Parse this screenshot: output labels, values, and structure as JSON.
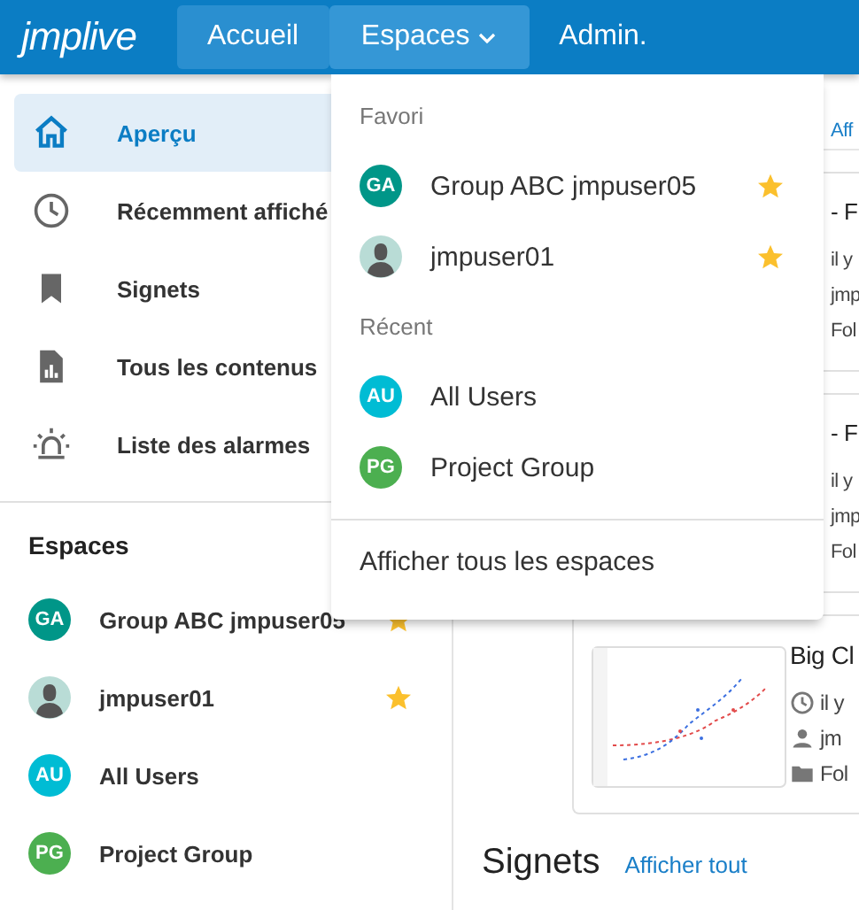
{
  "topbar": {
    "logo": "jmplive",
    "nav": [
      {
        "label": "Accueil",
        "selected": true,
        "open": false,
        "dropdown": false
      },
      {
        "label": "Espaces",
        "selected": false,
        "open": true,
        "dropdown": true
      },
      {
        "label": "Admin.",
        "selected": false,
        "open": false,
        "dropdown": false
      }
    ]
  },
  "sidebar": {
    "items": [
      {
        "label": "Aperçu",
        "kind": "home",
        "selected": true
      },
      {
        "label": "Récemment affiché",
        "kind": "clock",
        "selected": false
      },
      {
        "label": "Signets",
        "kind": "bookmark",
        "selected": false
      },
      {
        "label": "Tous les contenus",
        "kind": "report",
        "selected": false
      },
      {
        "label": "Liste des alarmes",
        "kind": "alarm",
        "selected": false
      }
    ],
    "spaces_title": "Espaces",
    "spaces": [
      {
        "name": "Group ABC jmpuser05",
        "avatar": {
          "kind": "initials",
          "text": "GA",
          "color": "#009688"
        },
        "favorite": true
      },
      {
        "name": "jmpuser01",
        "avatar": {
          "kind": "person"
        },
        "favorite": true
      },
      {
        "name": "All Users",
        "avatar": {
          "kind": "initials",
          "text": "AU",
          "color": "#00bcd4"
        },
        "favorite": false
      },
      {
        "name": "Project Group",
        "avatar": {
          "kind": "initials",
          "text": "PG",
          "color": "#4caf50"
        },
        "favorite": false
      }
    ]
  },
  "main": {
    "link": "Aff",
    "cards": [
      {
        "title": "- F",
        "time": "il y",
        "author": "jmp",
        "folder": "Fol",
        "thumbnail": false
      },
      {
        "title": "- F",
        "time": "il y",
        "author": "jmp",
        "folder": "Fol",
        "thumbnail": false
      },
      {
        "title": "Big Cl",
        "time": "il y",
        "author": "jm",
        "folder": "Fol",
        "thumbnail": true
      }
    ],
    "section_title": "Signets",
    "section_link": "Afficher tout"
  },
  "menu": {
    "groups": [
      {
        "title": "Favori",
        "items": [
          {
            "name": "Group ABC jmpuser05",
            "avatar": {
              "kind": "initials",
              "text": "GA",
              "color": "#009688"
            },
            "favorite": true
          },
          {
            "name": "jmpuser01",
            "avatar": {
              "kind": "person"
            },
            "favorite": true
          }
        ]
      },
      {
        "title": "Récent",
        "items": [
          {
            "name": "All Users",
            "avatar": {
              "kind": "initials",
              "text": "AU",
              "color": "#00bcd4"
            },
            "favorite": false
          },
          {
            "name": "Project Group",
            "avatar": {
              "kind": "initials",
              "text": "PG",
              "color": "#4caf50"
            },
            "favorite": false
          }
        ]
      }
    ],
    "footer": "Afficher tous les espaces"
  }
}
